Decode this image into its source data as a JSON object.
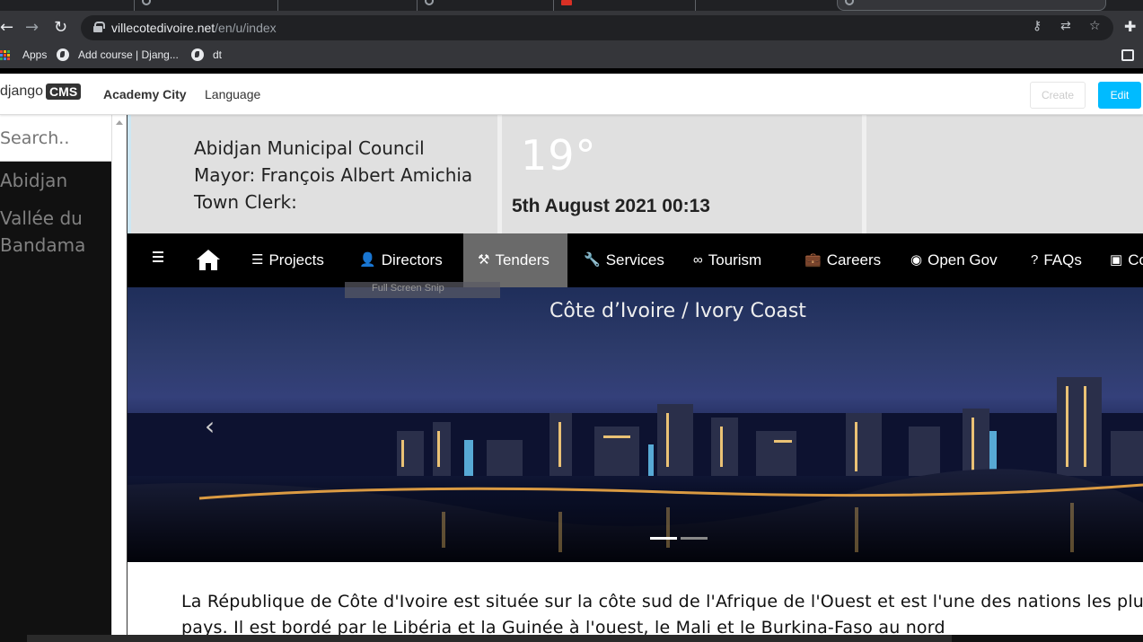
{
  "browser": {
    "tabs_count": 6,
    "url_host": "villecotedivoire.net",
    "url_path": "/en/u/index",
    "bookmarks": [
      {
        "label": "Apps"
      },
      {
        "label": "Add course | Djang..."
      },
      {
        "label": "dt"
      }
    ]
  },
  "cms_toolbar": {
    "logo_text": "django",
    "logo_badge": "CMS",
    "site_menu": "Academy City",
    "language_menu": "Language",
    "create_label": "Create",
    "edit_label": "Edit",
    "edit_color": "#00bbff"
  },
  "sidebar": {
    "search_placeholder": "Search..",
    "items": [
      {
        "label": "Abidjan"
      },
      {
        "label": "Vallée du Bandama"
      }
    ]
  },
  "header": {
    "council_name": "Abidjan Municipal Council",
    "mayor": "Mayor: François Albert Amichia",
    "clerk": "Town Clerk:",
    "temperature": "19°",
    "datetime": "5th August 2021 00:13"
  },
  "navbar": {
    "items": [
      {
        "label": "Projects",
        "icon": "projects-icon"
      },
      {
        "label": "Directors",
        "icon": "user-plus-icon"
      },
      {
        "label": "Tenders",
        "icon": "gavel-icon",
        "active": true
      },
      {
        "label": "Services",
        "icon": "wrench-icon"
      },
      {
        "label": "Tourism",
        "icon": "binoculars-icon"
      },
      {
        "label": "Careers",
        "icon": "briefcase-icon"
      },
      {
        "label": "Open Gov",
        "icon": "rss-icon"
      },
      {
        "label": "FAQs",
        "icon": "question-icon"
      },
      {
        "label": "Co",
        "icon": "contact-icon"
      }
    ],
    "tooltip": "Full Screen Snip"
  },
  "hero": {
    "caption": "Côte d’Ivoire / Ivory Coast",
    "slide_count": 2,
    "active_slide": 1
  },
  "article": {
    "text": "La République de Côte d'Ivoire est située sur la côte sud de l'Afrique de l'Ouest et est l'une des nations les plus riches du pays. Il est bordé par le Libéria et la Guinée à l'ouest, le Mali et le Burkina-Faso au nord"
  }
}
